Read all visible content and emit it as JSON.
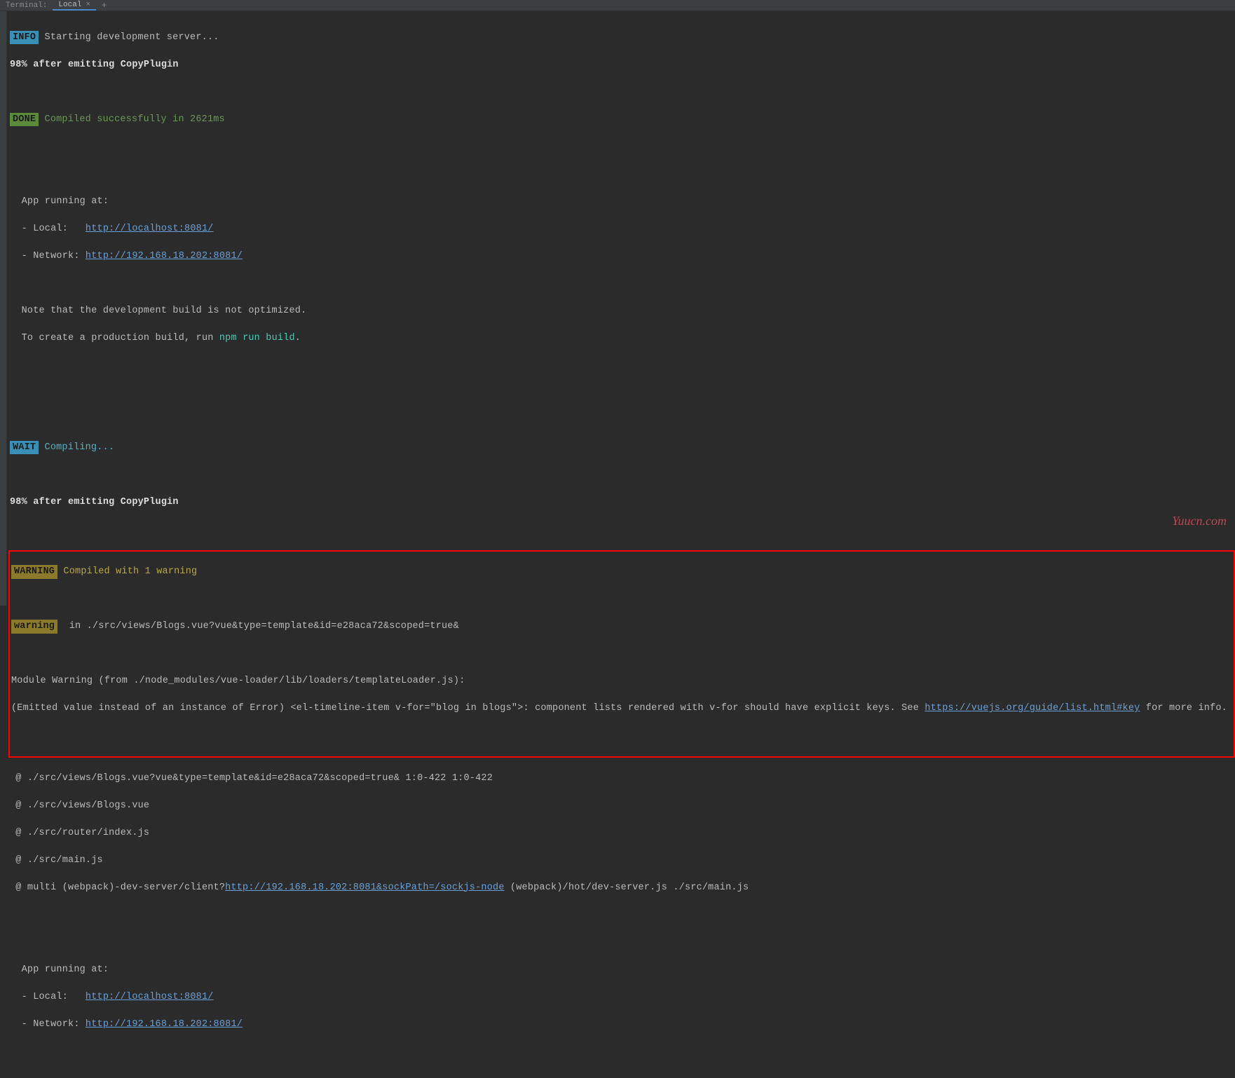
{
  "tabbar": {
    "label": "Terminal:",
    "active_tab": "Local",
    "add_icon": "+"
  },
  "output": {
    "info_badge": "INFO",
    "info_text": " Starting development server...",
    "progress_1": "98% after emitting CopyPlugin",
    "done_badge": "DONE",
    "done_text": " Compiled successfully in 2621ms",
    "app_running": "  App running at:",
    "local_label": "  - Local:   ",
    "local_url": "http://localhost:8081/",
    "network_label": "  - Network: ",
    "network_url": "http://192.168.18.202:8081/",
    "note_1": "  Note that the development build is not optimized.",
    "note_2a": "  To create a production build, run ",
    "note_2b": "npm run build",
    "note_2c": ".",
    "wait_badge": "WAIT",
    "wait_text": " Compiling...",
    "progress_2": "98% after emitting CopyPlugin",
    "warning_badge": "WARNING",
    "warning_text": " Compiled with 1 warning",
    "warning_lower_badge": "warning",
    "warning_lower_text": "  in ./src/views/Blogs.vue?vue&type=template&id=e28aca72&scoped=true&",
    "module_warning_1": "Module Warning (from ./node_modules/vue-loader/lib/loaders/templateLoader.js):",
    "module_warning_2a": "(Emitted value instead of an instance of Error) <el-timeline-item v-for=\"blog in blogs\">: component lists rendered with v-for should have explicit keys. See ",
    "module_warning_2_link": "https://vuejs.org/guide/list.html#key",
    "module_warning_2b": " for more info.",
    "trace_1": " @ ./src/views/Blogs.vue?vue&type=template&id=e28aca72&scoped=true& 1:0-422 1:0-422",
    "trace_2": " @ ./src/views/Blogs.vue",
    "trace_3": " @ ./src/router/index.js",
    "trace_4": " @ ./src/main.js",
    "trace_5a": " @ multi (webpack)-dev-server/client?",
    "trace_5_link": "http://192.168.18.202:8081&sockPath=/sockjs-node",
    "trace_5b": " (webpack)/hot/dev-server.js ./src/main.js",
    "app_running_2": "  App running at:",
    "local_label_2": "  - Local:   ",
    "local_url_2": "http://localhost:8081/",
    "network_label_2": "  - Network: ",
    "network_url_2": "http://192.168.18.202:8081/"
  },
  "watermark": "Yuucn.com"
}
